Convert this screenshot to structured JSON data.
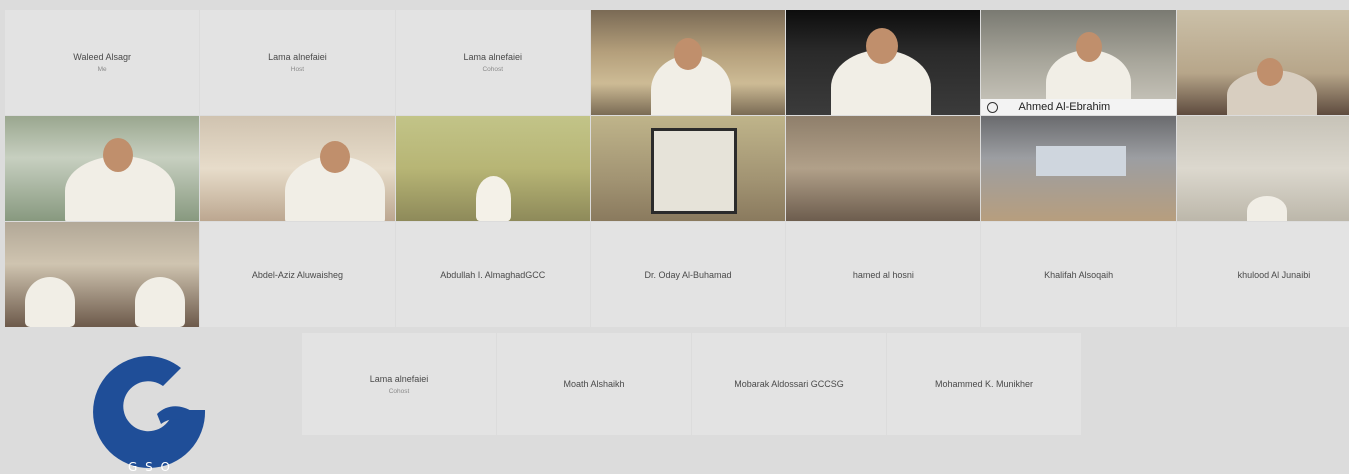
{
  "participants": [
    {
      "name": "Waleed Alsagr",
      "sub": "Me"
    },
    {
      "name": "Lama alnefaiei",
      "sub": "Host"
    },
    {
      "name": "Lama alnefaiei",
      "sub": "Cohost"
    },
    {
      "name": "",
      "video": true
    },
    {
      "name": "",
      "video": true
    },
    {
      "name": "Ahmed Al-Ebrahim",
      "video": true,
      "active": true
    },
    {
      "name": "",
      "video": true
    },
    {
      "name": "",
      "video": true
    },
    {
      "name": "",
      "video": true
    },
    {
      "name": "",
      "video": true
    },
    {
      "name": "",
      "video": true
    },
    {
      "name": "",
      "video": true
    },
    {
      "name": "",
      "video": true
    },
    {
      "name": "",
      "video": true
    },
    {
      "name": "",
      "video": true
    },
    {
      "name": "Abdel-Aziz Aluwaisheg"
    },
    {
      "name": "Abdullah I. AlmaghadGCC"
    },
    {
      "name": "Dr. Oday Al-Buhamad"
    },
    {
      "name": "hamed al hosni"
    },
    {
      "name": "Khalifah Alsoqaih"
    },
    {
      "name": "khulood Al Junaibi"
    }
  ],
  "bottom_row": [
    {
      "name": "Lama alnefaiei",
      "sub": "Cohost"
    },
    {
      "name": "Moath Alshaikh"
    },
    {
      "name": "Mobarak Aldossari GCCSG"
    },
    {
      "name": "Mohammed K. Munikher"
    }
  ],
  "logo": {
    "text": "G S O",
    "color": "#1f4e98"
  }
}
